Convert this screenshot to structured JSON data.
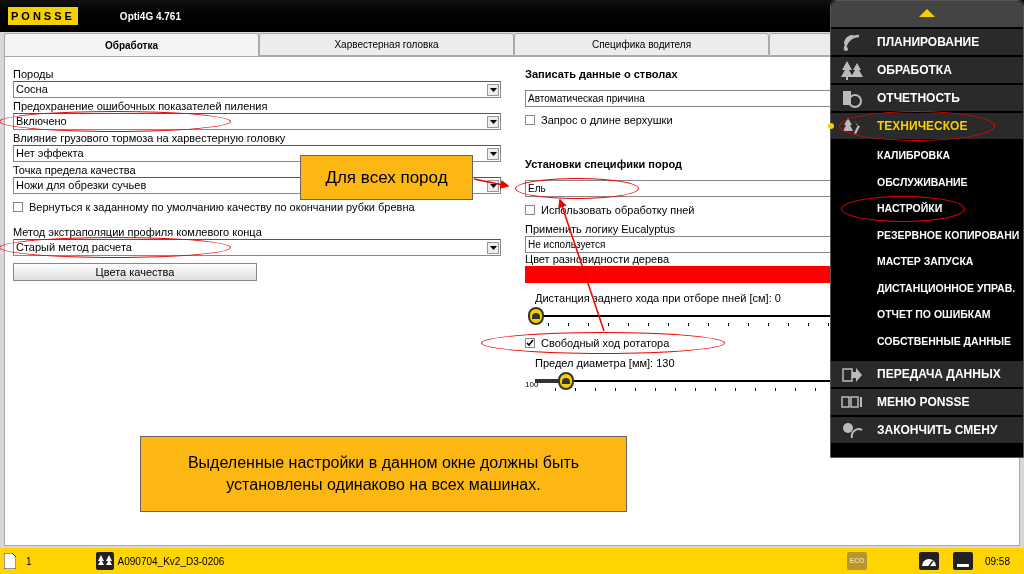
{
  "app": {
    "logo": "PONSSE",
    "title": "Opti4G 4.761"
  },
  "tabs": [
    {
      "label": "Обработка",
      "selected": true
    },
    {
      "label": "Харвестерная головка",
      "selected": false
    },
    {
      "label": "Специфика водителя",
      "selected": false
    },
    {
      "selected": false
    }
  ],
  "left": [
    {
      "kind": "select",
      "label": "Породы",
      "value": "Сосна"
    },
    {
      "kind": "select",
      "label": "Предохранение ошибочных показателей пиления",
      "value": "Включено",
      "highlighted": true
    },
    {
      "kind": "select",
      "label": "Влияние грузового тормоза на харвестерную головку",
      "value": "Нет эффекта"
    },
    {
      "kind": "select",
      "label": "Точка предела качества",
      "value": "Ножи для обрезки сучьев"
    },
    {
      "kind": "checkbox",
      "label": "Вернуться к заданному по умолчанию качеству по окончании рубки бревна",
      "checked": false
    },
    {
      "kind": "select",
      "label": "Метод экстраполяции профиля комлевого конца",
      "value": "Старый метод расчета",
      "highlighted": true
    },
    {
      "kind": "button",
      "label": "Цвета качества"
    }
  ],
  "right": [
    {
      "kind": "heading",
      "label": "Записать данные о стволах"
    },
    {
      "kind": "field",
      "value": "Автоматическая причина"
    },
    {
      "kind": "checkbox",
      "label": "Запрос о длине верхушки",
      "checked": false
    },
    {
      "kind": "heading",
      "label": "Установки специфики пород"
    },
    {
      "kind": "field",
      "value": "Ель",
      "highlighted": true
    },
    {
      "kind": "checkbox",
      "label": "Использовать обработку пней",
      "checked": false
    },
    {
      "kind": "field",
      "label": "Применить логику Eucalyptus",
      "value": "Не используется"
    },
    {
      "kind": "color",
      "label": "Цвет разновидности дерева",
      "color": "#ff0000"
    },
    {
      "kind": "slider",
      "label": "Дистанция заднего хода при отборе пней [см]: 0",
      "level": 0
    },
    {
      "kind": "checkbox",
      "label": "Свободный ход ротатора",
      "checked": true,
      "highlighted": true
    },
    {
      "kind": "slider",
      "label": "Предел диаметра [мм]: 130",
      "min_label": "100",
      "level": 0.05
    }
  ],
  "menu": [
    {
      "label": "ПЛАНИРОВАНИЕ",
      "selected": false
    },
    {
      "label": "ОБРАБОТКА",
      "selected": false
    },
    {
      "label": "ОТЧЕТНОСТЬ",
      "selected": false
    },
    {
      "label": "ТЕХНИЧЕСКОЕ",
      "selected": true,
      "highlighted": true,
      "children": [
        {
          "label": "КАЛИБРОВКА"
        },
        {
          "label": "ОБСЛУЖИВАНИЕ"
        },
        {
          "label": "НАСТРОЙКИ",
          "highlighted": true
        },
        {
          "label": "РЕЗЕРВНОЕ КОПИРОВАНИ"
        },
        {
          "label": "МАСТЕР ЗАПУСКА"
        },
        {
          "label": "ДИСТАНЦИОННОЕ УПРАВ."
        },
        {
          "label": "ОТЧЕТ ПО ОШИБКАМ"
        },
        {
          "label": "СОБСТВЕННЫЕ ДАННЫЕ"
        }
      ]
    },
    {
      "label": "ПЕРЕДАЧА ДАННЫХ",
      "selected": false
    },
    {
      "label": "МЕНЮ PONSSE",
      "selected": false
    },
    {
      "label": "ЗАКОНЧИТЬ СМЕНУ",
      "selected": false
    }
  ],
  "status_bar": {
    "page": "1",
    "file": "A090704_Kv2_D3-0206",
    "eco": "ECO",
    "time": "09:58"
  },
  "callouts": [
    "Для всех пород",
    "Выделенные настройки в данном окне должны быть установлены одинаково на всех машинах."
  ]
}
